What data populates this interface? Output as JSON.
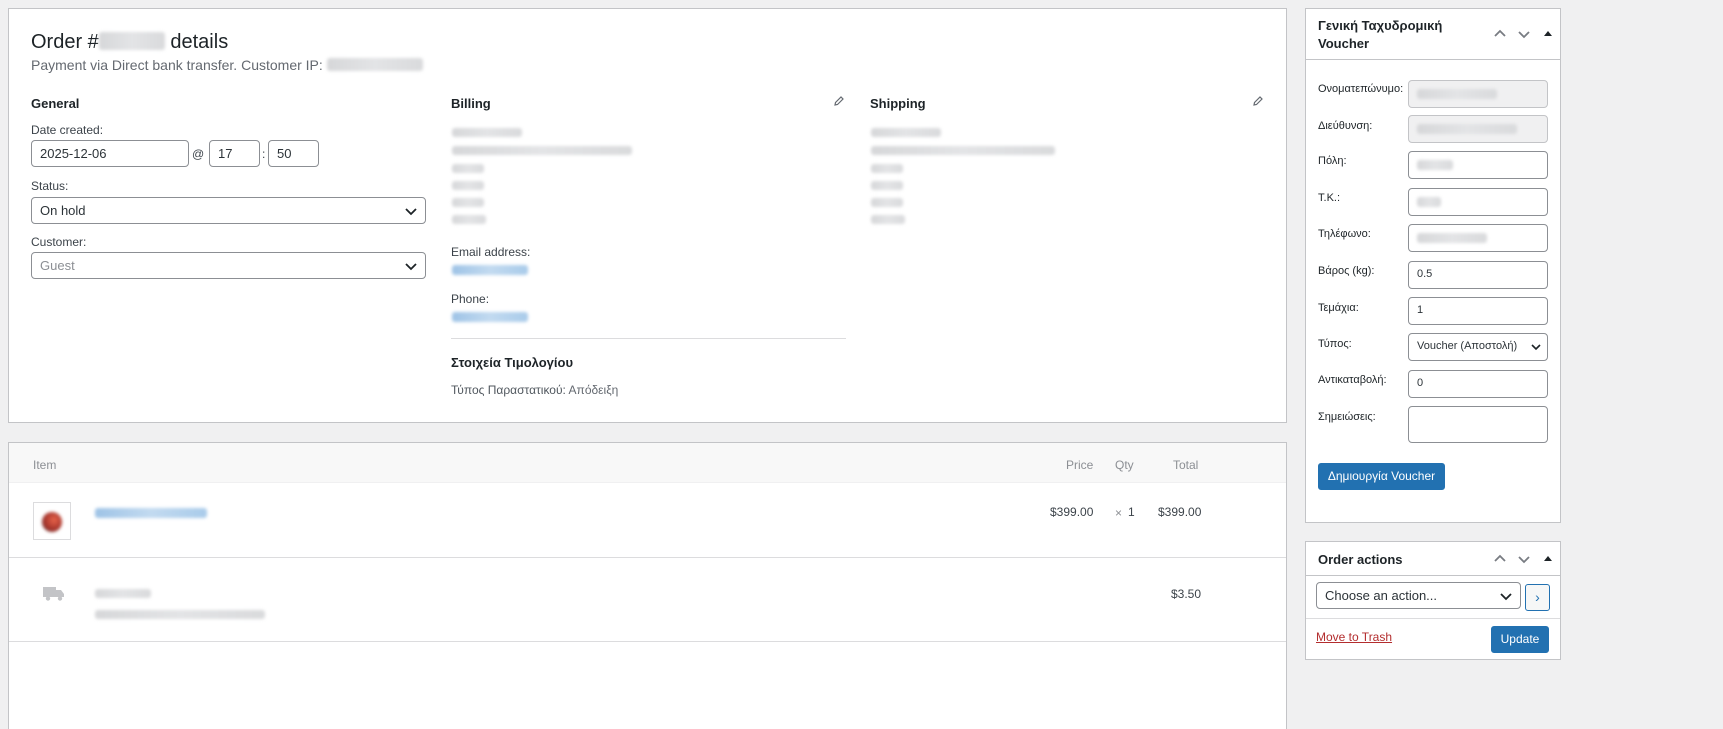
{
  "order": {
    "title_prefix": "Order #",
    "title_suffix": "details",
    "subtitle": "Payment via Direct bank transfer. Customer IP:",
    "general": {
      "title": "General",
      "date_label": "Date created:",
      "date_value": "2025-12-06",
      "at": "@",
      "hour": "17",
      "colon": ":",
      "minute": "50",
      "status_label": "Status:",
      "status_value": "On hold",
      "customer_label": "Customer:",
      "customer_placeholder": "Guest"
    },
    "billing": {
      "title": "Billing",
      "email_label": "Email address:",
      "phone_label": "Phone:",
      "invoice_title": "Στοιχεία Τιμολογίου",
      "invoice_type_label": "Τύπος Παραστατικού:",
      "invoice_type_value": "Απόδειξη"
    },
    "shipping": {
      "title": "Shipping"
    }
  },
  "items": {
    "headers": {
      "item": "Item",
      "price": "Price",
      "qty": "Qty",
      "total": "Total"
    },
    "rows": [
      {
        "price": "$399.00",
        "qty_x": "×",
        "qty": "1",
        "total": "$399.00"
      }
    ],
    "shipping_row": {
      "total": "$3.50"
    }
  },
  "voucher": {
    "title": "Γενική Ταχυδρομική Voucher",
    "fields": {
      "name_label": "Ονοματεπώνυμο:",
      "address_label": "Διεύθυνση:",
      "city_label": "Πόλη:",
      "zip_label": "Τ.Κ.:",
      "phone_label": "Τηλέφωνο:",
      "weight_label": "Βάρος (kg):",
      "weight_value": "0.5",
      "pieces_label": "Τεμάχια:",
      "pieces_value": "1",
      "type_label": "Τύπος:",
      "type_value": "Voucher (Αποστολή)",
      "cod_label": "Αντικαταβολή:",
      "cod_value": "0",
      "notes_label": "Σημειώσεις:"
    },
    "create_button": "Δημιουργία Voucher"
  },
  "actions": {
    "title": "Order actions",
    "select_value": "Choose an action...",
    "go_label": "›",
    "trash_link": "Move to Trash",
    "update_button": "Update"
  }
}
